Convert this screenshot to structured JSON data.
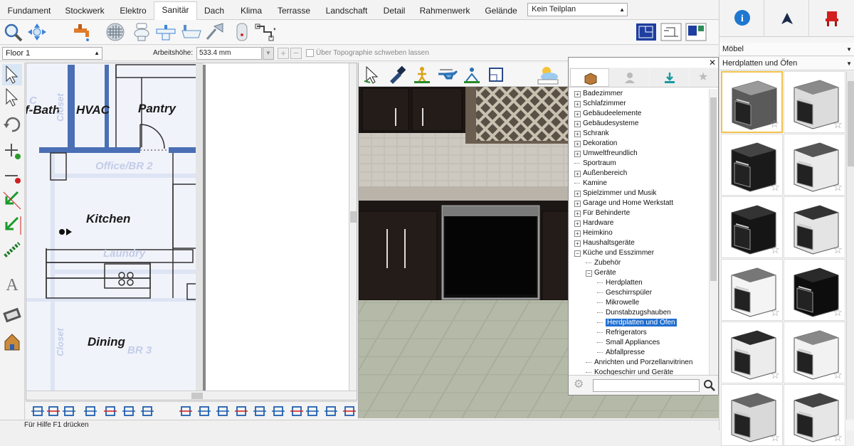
{
  "tabs": [
    {
      "label": "Fundament"
    },
    {
      "label": "Stockwerk"
    },
    {
      "label": "Elektro"
    },
    {
      "label": "Sanitär"
    },
    {
      "label": "Dach"
    },
    {
      "label": "Klima"
    },
    {
      "label": "Terrasse"
    },
    {
      "label": "Landschaft"
    },
    {
      "label": "Detail"
    },
    {
      "label": "Rahmenwerk"
    },
    {
      "label": "Gelände"
    }
  ],
  "active_tab": "Sanitär",
  "plan_select": {
    "value": "Kein Teilplan"
  },
  "options_bar": {
    "floor": "Floor 1",
    "working_height_label": "Arbeitshöhe:",
    "working_height_value": "533.4 mm",
    "topography_label": "Über Topographie schweben lassen"
  },
  "plan": {
    "rooms": [
      {
        "label": "f-Bath"
      },
      {
        "label": "HVAC"
      },
      {
        "label": "Pantry"
      },
      {
        "label": "Kitchen"
      },
      {
        "label": "Dining"
      }
    ],
    "ghost_labels": [
      {
        "label": "Office/BR 2"
      },
      {
        "label": "Laundry"
      },
      {
        "label": "BR 3"
      },
      {
        "label": "Closet"
      },
      {
        "label": "Closet"
      },
      {
        "label": "C"
      }
    ]
  },
  "library": {
    "items": [
      {
        "label": "Badezimmer",
        "expander": "+",
        "level": 0
      },
      {
        "label": "Schlafzimmer",
        "expander": "+",
        "level": 0
      },
      {
        "label": "Gebäudeelemente",
        "expander": "+",
        "level": 0
      },
      {
        "label": "Gebäudesysteme",
        "expander": "+",
        "level": 0
      },
      {
        "label": "Schrank",
        "expander": "+",
        "level": 0
      },
      {
        "label": "Dekoration",
        "expander": "+",
        "level": 0
      },
      {
        "label": "Umweltfreundlich",
        "expander": "+",
        "level": 0
      },
      {
        "label": "Sportraum",
        "expander": "",
        "level": 0
      },
      {
        "label": "Außenbereich",
        "expander": "+",
        "level": 0
      },
      {
        "label": "Kamine",
        "expander": "",
        "level": 0
      },
      {
        "label": "Spielzimmer und Musik",
        "expander": "+",
        "level": 0
      },
      {
        "label": "Garage und Home Werkstatt",
        "expander": "+",
        "level": 0
      },
      {
        "label": "Für Behinderte",
        "expander": "+",
        "level": 0
      },
      {
        "label": "Hardware",
        "expander": "+",
        "level": 0
      },
      {
        "label": "Heimkino",
        "expander": "+",
        "level": 0
      },
      {
        "label": "Haushaltsgeräte",
        "expander": "+",
        "level": 0
      },
      {
        "label": "Küche und Esszimmer",
        "expander": "−",
        "level": 0
      },
      {
        "label": "Zubehör",
        "expander": "",
        "level": 1
      },
      {
        "label": "Geräte",
        "expander": "−",
        "level": 1
      },
      {
        "label": "Herdplatten",
        "expander": "",
        "level": 2
      },
      {
        "label": "Geschirrspüler",
        "expander": "",
        "level": 2
      },
      {
        "label": "Mikrowelle",
        "expander": "",
        "level": 2
      },
      {
        "label": "Dunstabzugshauben",
        "expander": "",
        "level": 2
      },
      {
        "label": "Herdplatten und Öfen",
        "expander": "",
        "level": 2,
        "selected": true
      },
      {
        "label": "Refrigerators",
        "expander": "",
        "level": 2
      },
      {
        "label": "Small Appliances",
        "expander": "",
        "level": 2
      },
      {
        "label": "Abfallpresse",
        "expander": "",
        "level": 2
      },
      {
        "label": "Anrichten und Porzellanvitrinen",
        "expander": "",
        "level": 1
      },
      {
        "label": "Kochgeschirr und Geräte",
        "expander": "",
        "level": 1
      }
    ],
    "search_placeholder": ""
  },
  "right_panel": {
    "category": "Möbel",
    "subcategory": "Herdplatten und Öfen"
  },
  "status": "Für Hilfe F1 drücken",
  "colors": {
    "accent": "#1f6fd1",
    "selection_border": "#f3c24a",
    "plan_wall": "#4a6fb5"
  }
}
